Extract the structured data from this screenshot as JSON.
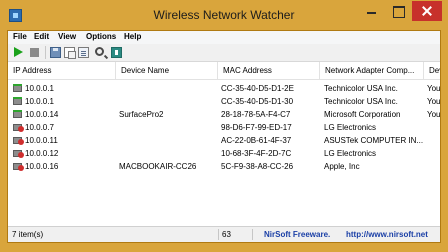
{
  "window": {
    "title": "Wireless Network Watcher"
  },
  "menu": {
    "items": [
      "File",
      "Edit",
      "View",
      "Options",
      "Help"
    ]
  },
  "toolbar": {
    "icons": [
      "start-icon",
      "stop-icon",
      "save-icon",
      "copy-icon",
      "html-report-icon",
      "find-icon",
      "exit-icon"
    ]
  },
  "table": {
    "headers": [
      "IP Address",
      "Device Name",
      "MAC Address",
      "Network Adapter Comp...",
      "Dev"
    ],
    "rows": [
      {
        "ip": "10.0.0.1",
        "name": "",
        "mac": "CC-35-40-D5-D1-2E",
        "vendor": "Technicolor USA Inc.",
        "extra": "You",
        "status": "ok"
      },
      {
        "ip": "10.0.0.1",
        "name": "",
        "mac": "CC-35-40-D5-D1-30",
        "vendor": "Technicolor USA Inc.",
        "extra": "You",
        "status": "ok"
      },
      {
        "ip": "10.0.0.14",
        "name": "SurfacePro2",
        "mac": "28-18-78-5A-F4-C7",
        "vendor": "Microsoft Corporation",
        "extra": "You",
        "status": "ok"
      },
      {
        "ip": "10.0.0.7",
        "name": "",
        "mac": "98-D6-F7-99-ED-17",
        "vendor": "LG Electronics",
        "extra": "",
        "status": "bad"
      },
      {
        "ip": "10.0.0.11",
        "name": "",
        "mac": "AC-22-0B-61-4F-37",
        "vendor": "ASUSTek COMPUTER IN...",
        "extra": "",
        "status": "bad"
      },
      {
        "ip": "10.0.0.12",
        "name": "",
        "mac": "10-68-3F-4F-2D-7C",
        "vendor": "LG Electronics",
        "extra": "",
        "status": "bad"
      },
      {
        "ip": "10.0.0.16",
        "name": "MACBOOKAIR-CC26",
        "mac": "5C-F9-38-A8-CC-26",
        "vendor": "Apple, Inc",
        "extra": "",
        "status": "bad"
      }
    ]
  },
  "statusbar": {
    "count": "7 item(s)",
    "number": "63",
    "brand": "NirSoft Freeware.",
    "link": "http://www.nirsoft.net"
  },
  "colors": {
    "frame": "#d9a53c",
    "close": "#c7312b",
    "link": "#1a3fa6"
  }
}
